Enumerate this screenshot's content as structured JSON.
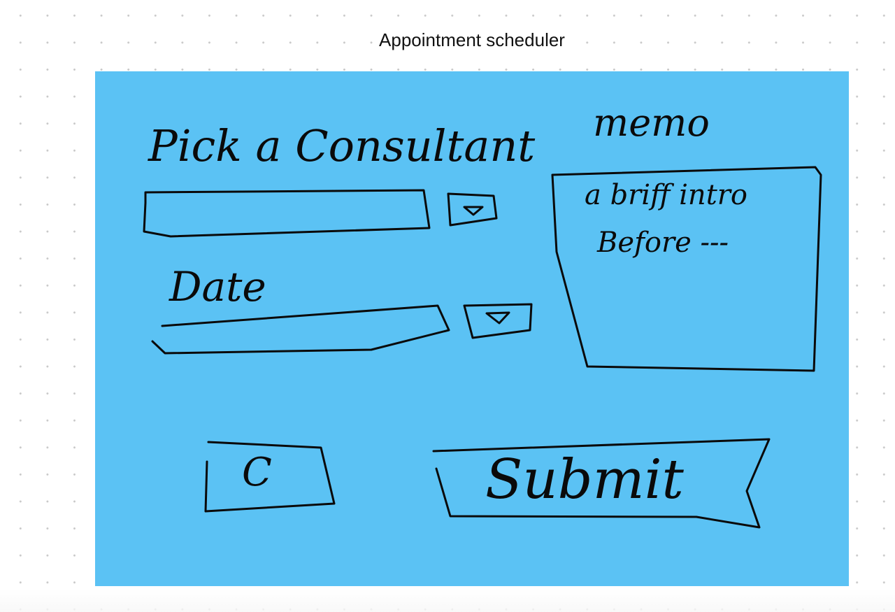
{
  "canvas": {
    "frame_title": "Appointment scheduler",
    "background_color": "#ffffff",
    "grid_dot_color": "#c9c9c9"
  },
  "artboard": {
    "fill_color": "#5bc2f4",
    "ink_color": "#0a0a0a",
    "consultant": {
      "label": "Pick a Consultant",
      "dropdown_icon": "triangle-down-icon"
    },
    "date": {
      "label": "Date",
      "dropdown_icon": "triangle-down-icon"
    },
    "memo": {
      "label": "memo",
      "lines": [
        "a briff intro",
        "Before ---"
      ]
    },
    "refresh_button": {
      "icon": "refresh-arrow-icon",
      "label": "C"
    },
    "submit_button": {
      "label": "Submit"
    }
  }
}
